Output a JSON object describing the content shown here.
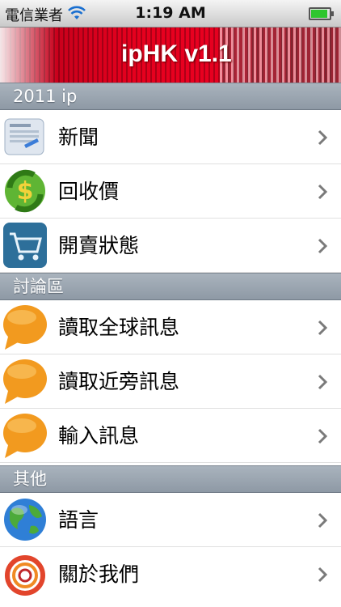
{
  "status_bar": {
    "carrier": "電信業者",
    "time": "1:19 AM"
  },
  "banner": {
    "title": "ipHK v1.1"
  },
  "sections": [
    {
      "header": "2011 ip",
      "items": [
        {
          "label": "新聞",
          "icon": "newspaper-icon"
        },
        {
          "label": "回收價",
          "icon": "recycle-dollar-icon"
        },
        {
          "label": "開賣狀態",
          "icon": "shopping-cart-icon"
        }
      ]
    },
    {
      "header": "討論區",
      "items": [
        {
          "label": "讀取全球訊息",
          "icon": "chat-bubble-icon"
        },
        {
          "label": "讀取近旁訊息",
          "icon": "chat-bubble-icon"
        },
        {
          "label": "輸入訊息",
          "icon": "chat-bubble-icon"
        }
      ]
    },
    {
      "header": "其他",
      "items": [
        {
          "label": "語言",
          "icon": "globe-icon"
        },
        {
          "label": "關於我們",
          "icon": "ring-logo-icon"
        }
      ]
    }
  ]
}
